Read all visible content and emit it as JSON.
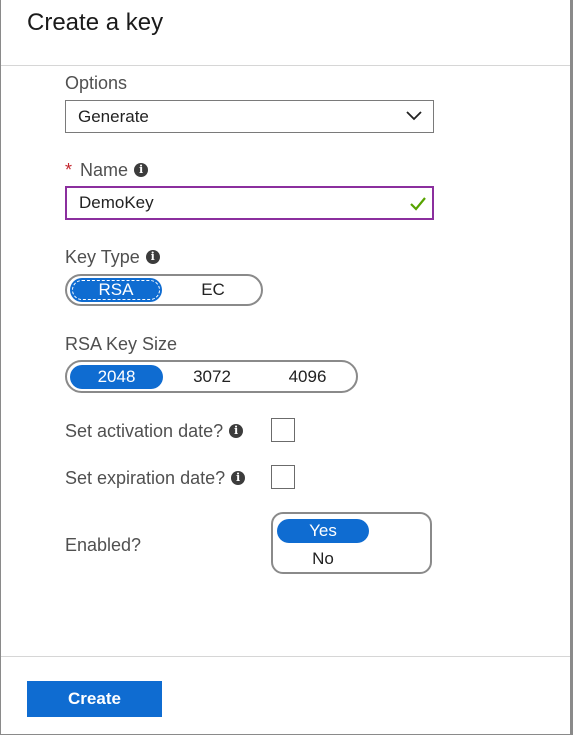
{
  "header": {
    "title": "Create a key"
  },
  "options": {
    "label": "Options",
    "value": "Generate"
  },
  "name": {
    "required_marker": "*",
    "label": "Name",
    "value": "DemoKey"
  },
  "key_type": {
    "label": "Key Type",
    "choices": [
      "RSA",
      "EC"
    ],
    "selected": "RSA"
  },
  "rsa_key_size": {
    "label": "RSA Key Size",
    "choices": [
      "2048",
      "3072",
      "4096"
    ],
    "selected": "2048"
  },
  "activation": {
    "label": "Set activation date?",
    "checked": false
  },
  "expiration": {
    "label": "Set expiration date?",
    "checked": false
  },
  "enabled": {
    "label": "Enabled?",
    "choices": [
      "Yes",
      "No"
    ],
    "selected": "Yes"
  },
  "footer": {
    "create_label": "Create"
  },
  "colors": {
    "accent": "#0f6cd1",
    "focus_border": "#8b2f9e",
    "valid_check": "#57a300",
    "required": "#c4262e"
  },
  "icons": {
    "info": "info-icon",
    "dropdown": "chevron-down-icon",
    "valid": "checkmark-icon"
  }
}
